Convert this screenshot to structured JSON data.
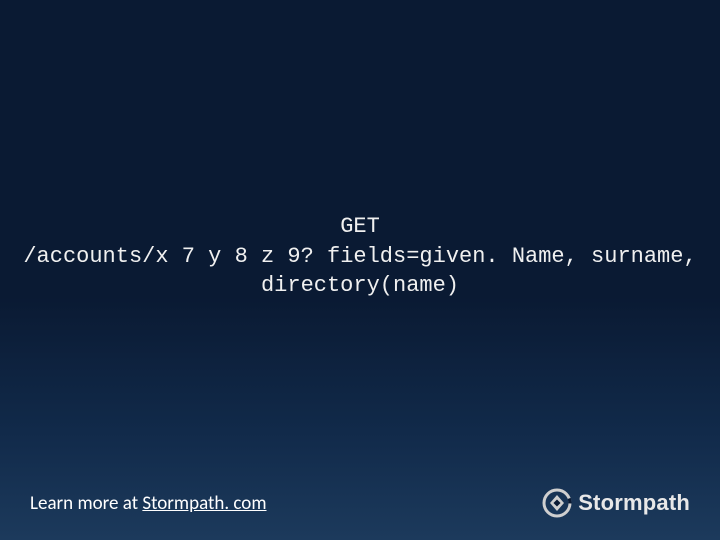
{
  "code": {
    "line1": "GET",
    "line2": "/accounts/x 7 y 8 z 9? fields=given. Name, surname,",
    "line3": "directory(name)"
  },
  "footer": {
    "prefix": "Learn more at ",
    "link_text": "Stormpath. com"
  },
  "brand": {
    "name": "Stormpath",
    "icon": "stormpath-logo-icon"
  }
}
